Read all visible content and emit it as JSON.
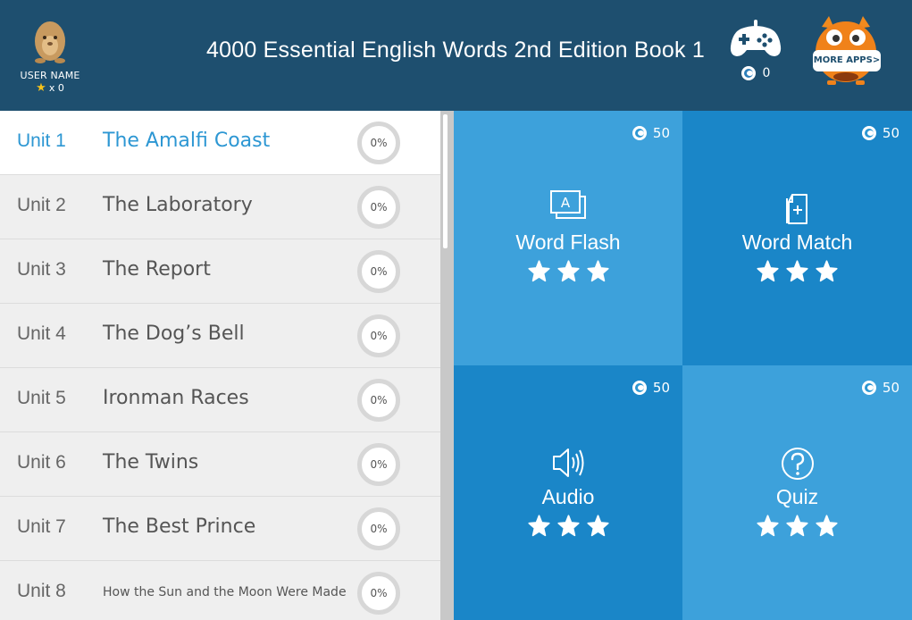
{
  "header": {
    "title": "4000 Essential English Words 2nd Edition Book 1",
    "user_name": "USER NAME",
    "user_stars": "x 0",
    "coin_count": "0",
    "more_apps_label": "MORE APPS>"
  },
  "units": [
    {
      "num": "Unit 1",
      "name": "The Amalfi Coast",
      "progress": "0%"
    },
    {
      "num": "Unit 2",
      "name": "The Laboratory",
      "progress": "0%"
    },
    {
      "num": "Unit 3",
      "name": "The Report",
      "progress": "0%"
    },
    {
      "num": "Unit 4",
      "name": "The Dog’s Bell",
      "progress": "0%"
    },
    {
      "num": "Unit 5",
      "name": "Ironman Races",
      "progress": "0%"
    },
    {
      "num": "Unit 6",
      "name": "The Twins",
      "progress": "0%"
    },
    {
      "num": "Unit 7",
      "name": "The Best Prince",
      "progress": "0%"
    },
    {
      "num": "Unit 8",
      "name": "How the Sun and the Moon Were Made",
      "progress": "0%"
    }
  ],
  "activities": [
    {
      "label": "Word Flash",
      "coins": "50",
      "icon": "word-flash-icon"
    },
    {
      "label": "Word Match",
      "coins": "50",
      "icon": "word-match-icon"
    },
    {
      "label": "Audio",
      "coins": "50",
      "icon": "speaker-icon"
    },
    {
      "label": "Quiz",
      "coins": "50",
      "icon": "question-icon"
    }
  ],
  "colors": {
    "header_bg": "#1e4f6f",
    "active_unit": "#2d97d3",
    "tile_light": "#3da1db",
    "tile_dark": "#1a86c8"
  }
}
